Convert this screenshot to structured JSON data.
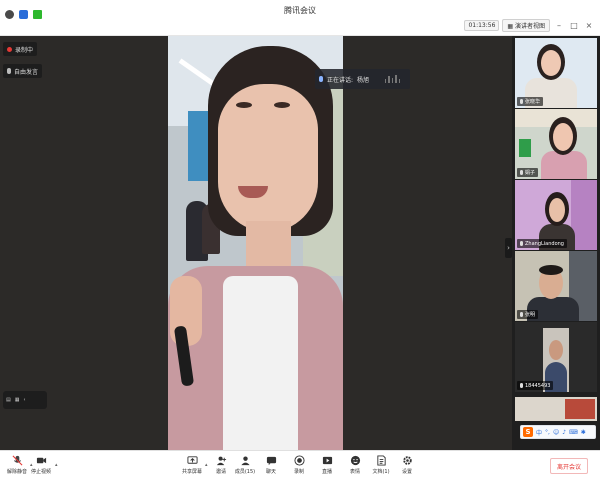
{
  "window": {
    "title": "腾讯会议",
    "timer": "01:13:56",
    "view_mode": "演讲者视图"
  },
  "stage": {
    "recording_label": "录制中",
    "audio_badge": "自由发言",
    "speaking_prefix": "正在讲话:",
    "speaker_name": "杨旭"
  },
  "participants": [
    {
      "name": "张晓华"
    },
    {
      "name": "娟子"
    },
    {
      "name": "ZhangLiandong"
    },
    {
      "name": "张明"
    },
    {
      "name": "18445493"
    }
  ],
  "toolbar": {
    "mute_label": "解除静音",
    "video_label": "停止视频",
    "share_label": "共享屏幕",
    "invite_label": "邀请",
    "members_label": "成员(15)",
    "chat_label": "聊天",
    "record_label": "录制",
    "live_label": "直播",
    "reaction_label": "表情",
    "docs_label": "文档(1)",
    "settings_label": "设置",
    "leave_label": "离开会议"
  },
  "ime_bar": {
    "brand": "S",
    "mode": "中"
  },
  "colors": {
    "accent": "#2a6dd9",
    "danger": "#e53935",
    "record": "#e53935"
  }
}
